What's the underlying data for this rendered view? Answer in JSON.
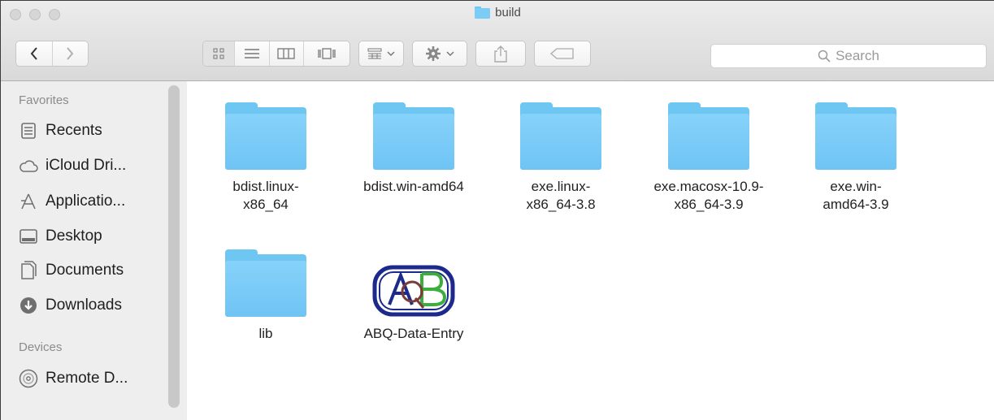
{
  "window": {
    "title": "build"
  },
  "toolbar": {
    "search_placeholder": "Search"
  },
  "sidebar": {
    "favorites_header": "Favorites",
    "devices_header": "Devices",
    "favorites": [
      {
        "label": "Recents",
        "icon": "recents-icon"
      },
      {
        "label": "iCloud Dri...",
        "icon": "cloud-icon"
      },
      {
        "label": "Applicatio...",
        "icon": "applications-icon"
      },
      {
        "label": "Desktop",
        "icon": "desktop-icon"
      },
      {
        "label": "Documents",
        "icon": "documents-icon"
      },
      {
        "label": "Downloads",
        "icon": "downloads-icon"
      }
    ],
    "devices": [
      {
        "label": "Remote D...",
        "icon": "disc-icon"
      }
    ]
  },
  "files": [
    {
      "line1": "bdist.linux-",
      "line2": "x86_64",
      "kind": "folder"
    },
    {
      "line1": "bdist.win-amd64",
      "line2": "",
      "kind": "folder"
    },
    {
      "line1": "exe.linux-",
      "line2": "x86_64-3.8",
      "kind": "folder"
    },
    {
      "line1": "exe.macosx-10.9-",
      "line2": "x86_64-3.9",
      "kind": "folder"
    },
    {
      "line1": "exe.win-",
      "line2": "amd64-3.9",
      "kind": "folder"
    },
    {
      "line1": "lib",
      "line2": "",
      "kind": "folder"
    },
    {
      "line1": "ABQ-Data-Entry",
      "line2": "",
      "kind": "app"
    }
  ],
  "colors": {
    "folder": "#6ec6f3",
    "sidebar_bg": "#eeeeee",
    "app_border": "#1c2a8c",
    "app_green": "#3cae3c"
  }
}
